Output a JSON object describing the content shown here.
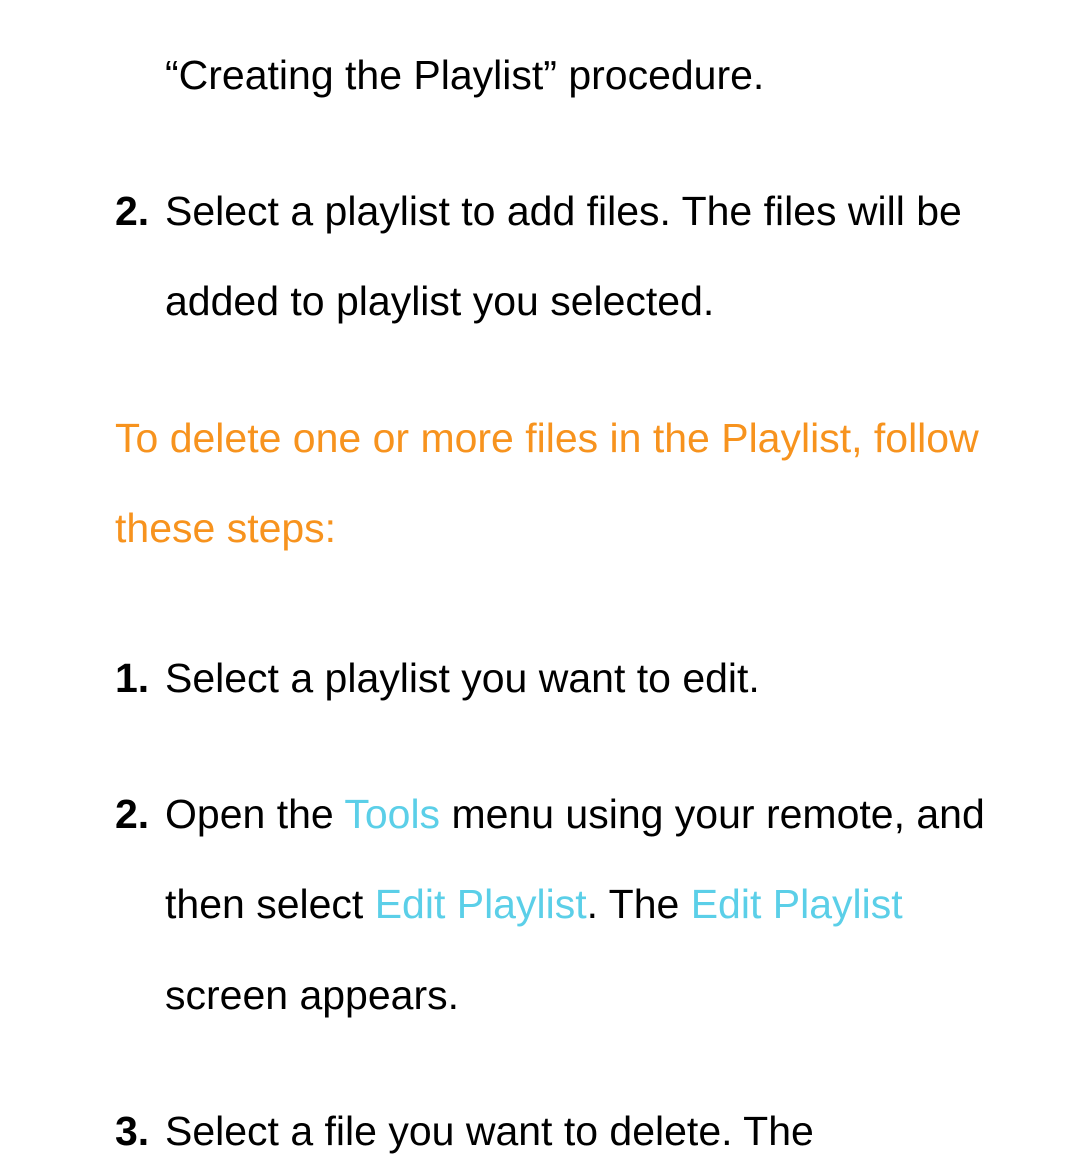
{
  "topFragment": "“Creating the Playlist” procedure.",
  "addFiles": {
    "step2": {
      "number": "2.",
      "text": "Select a playlist to add files. The files will be added to playlist you selected."
    }
  },
  "deleteSection": {
    "heading": "To delete one or more files in the Playlist, follow these steps:",
    "step1": {
      "number": "1.",
      "text": "Select a playlist you want to edit."
    },
    "step2": {
      "number": "2.",
      "prefix": "Open the ",
      "toolsLabel": "Tools",
      "middle1": " menu using your remote, and then select ",
      "editPlaylist1": "Edit Playlist",
      "period": ". The ",
      "editPlaylist2": "Edit Playlist",
      "suffix": " screen appears."
    },
    "step3": {
      "number": "3.",
      "text": "Select a file you want to delete. The"
    }
  }
}
